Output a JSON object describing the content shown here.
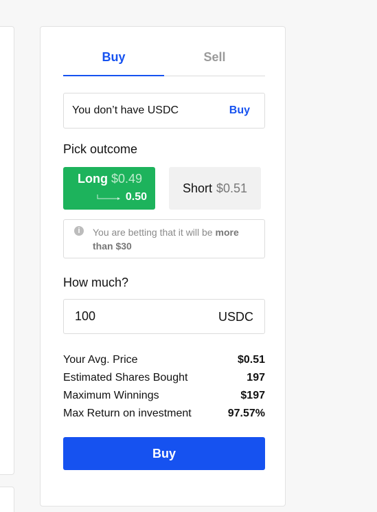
{
  "tabs": [
    {
      "label": "Buy",
      "active": true
    },
    {
      "label": "Sell",
      "active": false
    }
  ],
  "notice": {
    "text": "You don’t have USDC",
    "link": "Buy"
  },
  "pick_outcome": {
    "label": "Pick outcome",
    "long": {
      "name": "Long",
      "price": "$0.49",
      "new_price": "0.50"
    },
    "short": {
      "name": "Short",
      "price": "$0.51"
    }
  },
  "hint": {
    "prefix": "You are betting that it will be",
    "emphasis": "more than $30"
  },
  "amount": {
    "label": "How much?",
    "value": "100",
    "unit": "USDC"
  },
  "stats": [
    {
      "label": "Your Avg. Price",
      "value": "$0.51"
    },
    {
      "label": "Estimated Shares Bought",
      "value": "197"
    },
    {
      "label": "Maximum Winnings",
      "value": "$197"
    },
    {
      "label": "Max Return on investment",
      "value": "97.57%"
    }
  ],
  "submit_label": "Buy",
  "colors": {
    "accent": "#1652f0",
    "long": "#1db35c",
    "short_bg": "#f1f1f1"
  }
}
